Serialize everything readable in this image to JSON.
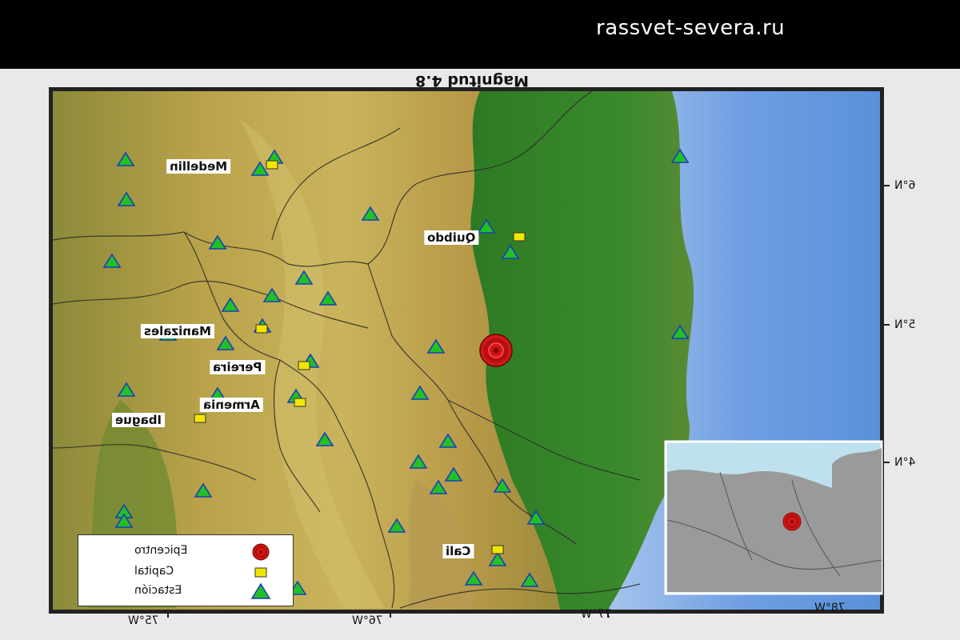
{
  "watermark": "rassvet-severa.ru",
  "map": {
    "title": "Magnitud 4.8",
    "cities": [
      {
        "name": "Medellin",
        "type": "capital"
      },
      {
        "name": "Quibdo",
        "type": "capital"
      },
      {
        "name": "Manizales",
        "type": "capital"
      },
      {
        "name": "Pereira",
        "type": "capital"
      },
      {
        "name": "Armenia",
        "type": "capital"
      },
      {
        "name": "Ibague",
        "type": "capital"
      },
      {
        "name": "Cali",
        "type": "capital"
      }
    ],
    "longitude_labels": [
      "75°W",
      "76°W",
      "77°W",
      "78°W"
    ],
    "latitude_labels": [
      "6°N",
      "5°N",
      "4°N"
    ],
    "legend": {
      "epicenter": "Epicentro",
      "capital": "Capital",
      "station": "Estación"
    },
    "colors": {
      "epicenter": "#d01010",
      "capital": "#f2e600",
      "station": "#22c022",
      "station_border": "#1a3dbd",
      "ocean": "#6e9fe0",
      "lowland": "#2f7a22",
      "highland": "#b8a046"
    }
  }
}
